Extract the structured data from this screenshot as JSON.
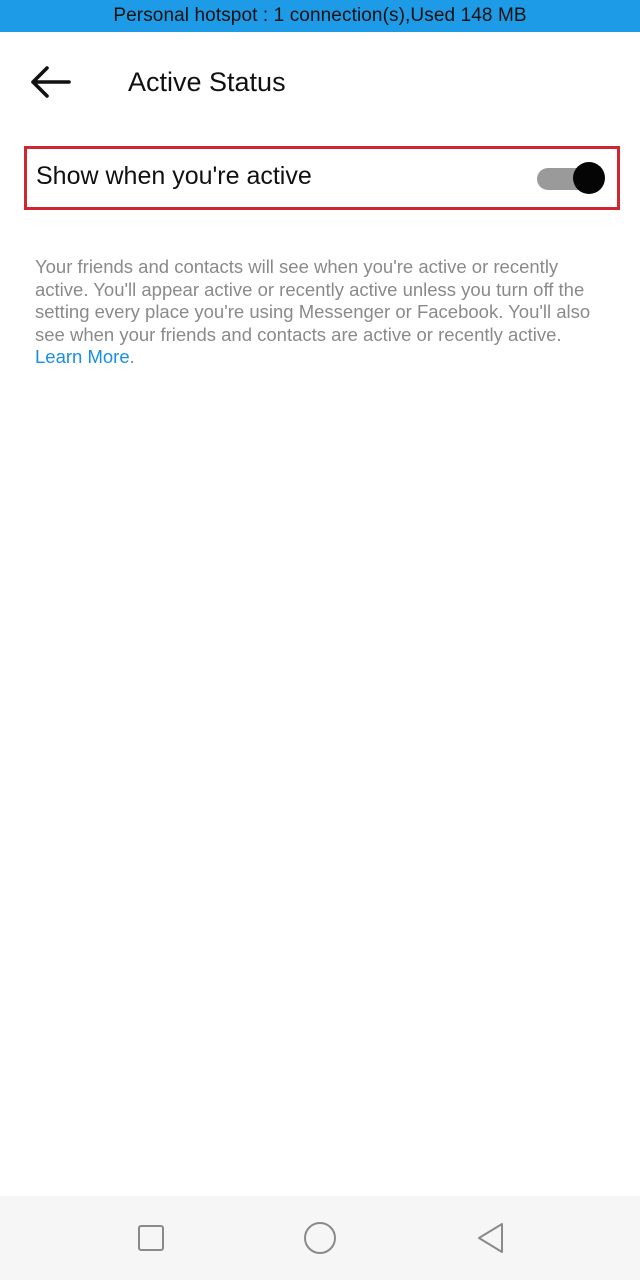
{
  "status_bar": {
    "text": "Personal hotspot : 1 connection(s),Used  148 MB",
    "background": "#1e9be6"
  },
  "header": {
    "back_icon": "arrow-left-icon",
    "title": "Active Status"
  },
  "setting": {
    "label": "Show when you're active",
    "toggle_state": true,
    "highlight_color": "#d0262f"
  },
  "description": {
    "text": "Your friends and contacts will see when you're active or recently active. You'll appear active or recently active unless you turn off the setting every place you're using Messenger or Facebook. You'll also see when your friends and contacts are active or recently active.",
    "link_text": "Learn More",
    "link_color": "#1a8fe0"
  },
  "nav_bar": {
    "recents_icon": "square-icon",
    "home_icon": "circle-icon",
    "back_icon": "triangle-back-icon"
  }
}
